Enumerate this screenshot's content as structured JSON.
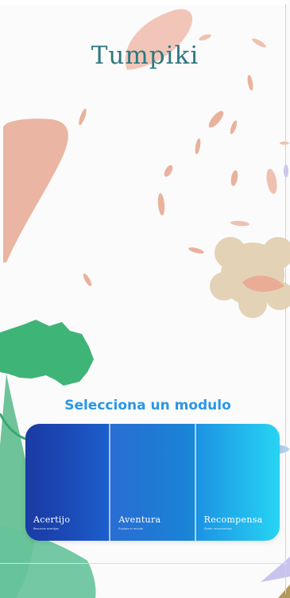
{
  "app": {
    "logo": "Tumpiki"
  },
  "main": {
    "section_title": "Selecciona un modulo"
  },
  "modules": [
    {
      "name": "Acertijo",
      "subtitle": "Resuelve acertijos"
    },
    {
      "name": "Aventura",
      "subtitle": "Explora el mundo"
    },
    {
      "name": "Recompensa",
      "subtitle": "Obtén recompensas"
    }
  ],
  "colors": {
    "accent": "#2b97e3",
    "logo": "#2f7780",
    "petal": "#e9b29d",
    "tree": "#3fb477",
    "dandelion": "#e3d2b6",
    "module_start": "#1f48b7",
    "module_end": "#27d4f3"
  }
}
